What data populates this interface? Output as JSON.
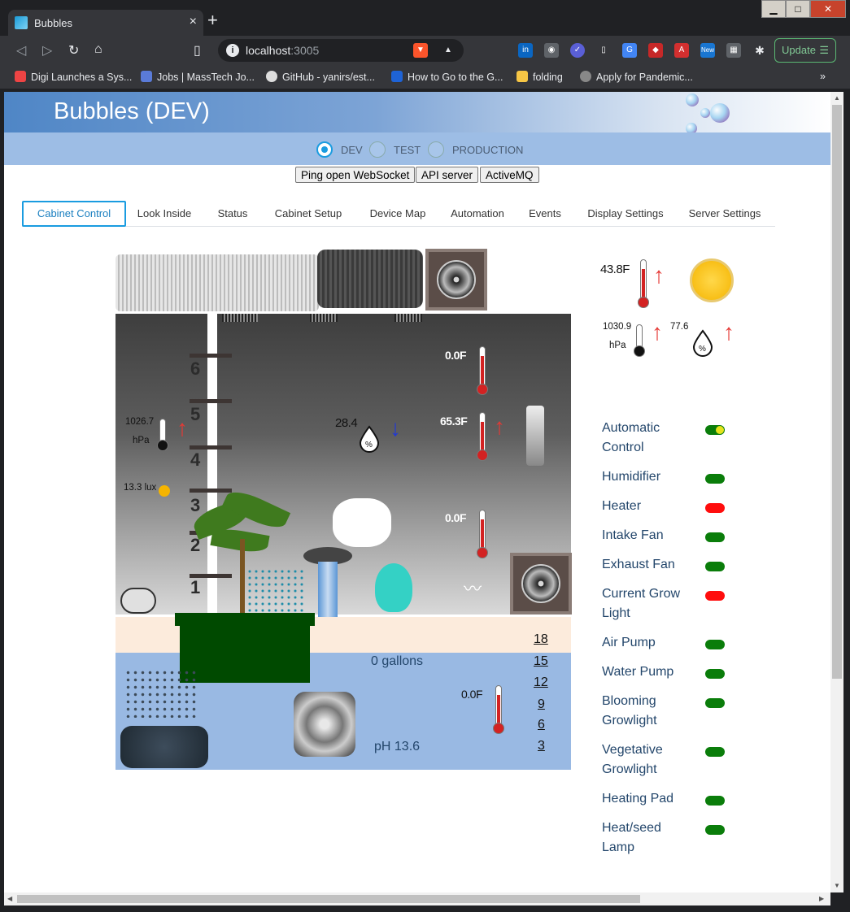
{
  "browser": {
    "tab_title": "Bubbles",
    "url_host": "localhost",
    "url_port": ":3005",
    "update_label": "Update",
    "bookmarks": [
      "Digi Launches a Sys...",
      "Jobs | MassTech Jo...",
      "GitHub - yanirs/est...",
      "How to Go to the G...",
      "folding",
      "Apply for Pandemic..."
    ]
  },
  "app": {
    "title": "Bubbles (DEV)",
    "environments": [
      "DEV",
      "TEST",
      "PRODUCTION"
    ],
    "selected_environment": "DEV",
    "buttons": [
      "Ping open WebSocket",
      "API server",
      "ActiveMQ"
    ],
    "tabs": [
      "Cabinet Control",
      "Look Inside",
      "Status",
      "Cabinet Setup",
      "Device Map",
      "Automation",
      "Events",
      "Display Settings",
      "Server Settings"
    ],
    "active_tab": "Cabinet Control"
  },
  "cabinet": {
    "shelf_numbers": [
      "6",
      "5",
      "4",
      "3",
      "2",
      "1"
    ],
    "temp_top": "0.0F",
    "temp_mid": "65.3F",
    "temp_low": "0.0F",
    "pressure_value": "1026.7",
    "pressure_unit": "hPa",
    "humidity_value": "28.4",
    "light_value": "13.3 lux",
    "water_volume": "0 gallons",
    "water_temp": "0.0F",
    "water_ph": "pH 13.6",
    "water_gauge": [
      "18",
      "15",
      "12",
      "9",
      "6",
      "3"
    ]
  },
  "outside": {
    "temp": "43.8F",
    "pressure_value": "1030.9",
    "pressure_unit": "hPa",
    "humidity_value": "77.6"
  },
  "controls": [
    {
      "label": "Automatic Control",
      "state": "auto"
    },
    {
      "label": "Humidifier",
      "state": "on"
    },
    {
      "label": "Heater",
      "state": "off"
    },
    {
      "label": "Intake Fan",
      "state": "on"
    },
    {
      "label": "Exhaust Fan",
      "state": "on"
    },
    {
      "label": "Current Grow Light",
      "state": "off"
    },
    {
      "label": "Air Pump",
      "state": "on"
    },
    {
      "label": "Water Pump",
      "state": "on"
    },
    {
      "label": "Blooming Growlight",
      "state": "on"
    },
    {
      "label": "Vegetative Growlight",
      "state": "on"
    },
    {
      "label": "Heating Pad",
      "state": "on"
    },
    {
      "label": "Heat/seed Lamp",
      "state": "on"
    }
  ],
  "colors": {
    "header_blue": "#4f86c6",
    "env_bar": "#9dbde5",
    "accent": "#1a9ce0",
    "led_on": "#0a7d0a",
    "led_off": "#ff0d0d",
    "label_text": "#23466b"
  }
}
